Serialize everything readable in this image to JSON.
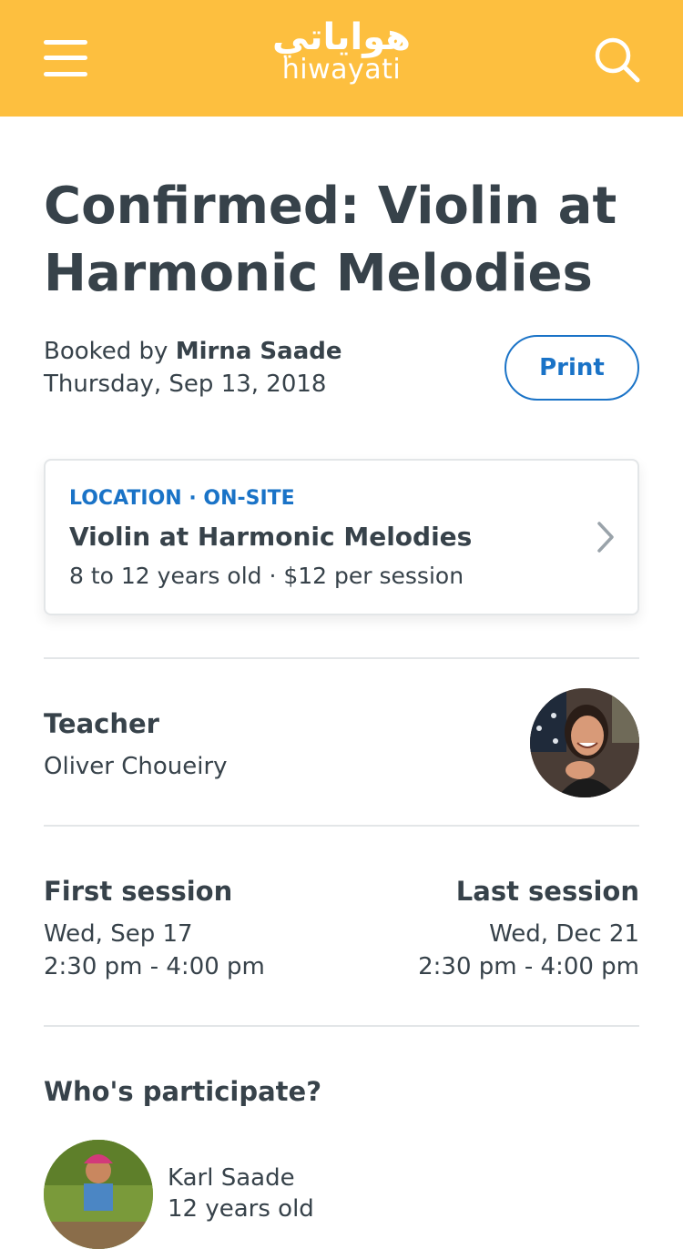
{
  "header": {
    "menu_icon": "hamburger-menu-icon",
    "logo_arabic": "هواياتي",
    "logo_latin": "hiwayati",
    "search_icon": "search-icon",
    "background_color": "#fdbf3f"
  },
  "booking": {
    "title": "Confirmed: Violin at Harmonic Melodies",
    "booked_by_prefix": "Booked by",
    "booked_by_name": "Mirna Saade",
    "date": "Thursday, Sep 13, 2018",
    "print_label": "Print"
  },
  "location_card": {
    "kicker": "LOCATION · ON-SITE",
    "title": "Violin at Harmonic Melodies",
    "subtitle": "8 to 12 years old · $12 per session",
    "chevron_icon": "chevron-right-icon"
  },
  "teacher": {
    "label": "Teacher",
    "name": "Oliver Choueiry"
  },
  "sessions": {
    "first_label": "First session",
    "first_date": "Wed, Sep 17",
    "first_time": "2:30 pm - 4:00 pm",
    "last_label": "Last session",
    "last_date": "Wed, Dec 21",
    "last_time": "2:30 pm - 4:00 pm"
  },
  "participants": {
    "label": "Who's participate?",
    "items": [
      {
        "name": "Karl Saade",
        "age": "12 years old"
      }
    ]
  },
  "colors": {
    "accent_blue": "#1a73c7",
    "text_dark": "#37424a",
    "divider": "#e3e6e8"
  }
}
